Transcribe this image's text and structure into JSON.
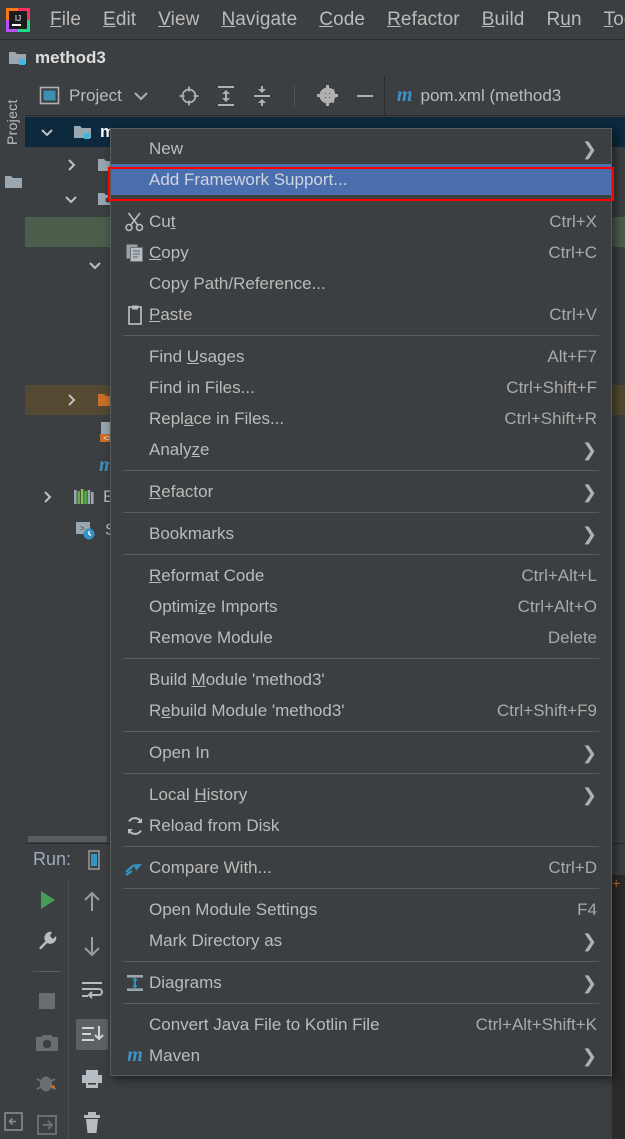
{
  "app": {
    "logo_text": "IJ",
    "menubar": [
      {
        "label": "File",
        "mnemonic": "F"
      },
      {
        "label": "Edit",
        "mnemonic": "E"
      },
      {
        "label": "View",
        "mnemonic": "V"
      },
      {
        "label": "Navigate",
        "mnemonic": "N"
      },
      {
        "label": "Code",
        "mnemonic": "C"
      },
      {
        "label": "Refactor",
        "mnemonic": "R"
      },
      {
        "label": "Build",
        "mnemonic": "B"
      },
      {
        "label": "Run",
        "mnemonic": "u"
      },
      {
        "label": "Tools",
        "mnemonic": "T"
      }
    ],
    "project_name": "method3"
  },
  "toolwindow": {
    "vertical_tab": "Project",
    "title": "Project",
    "buttons": [
      {
        "name": "locate-icon"
      },
      {
        "name": "expand-all-icon"
      },
      {
        "name": "collapse-all-icon"
      },
      {
        "name": "settings-gear-icon"
      },
      {
        "name": "hide-icon"
      }
    ]
  },
  "editor": {
    "tab_label": "pom.xml (method3",
    "tab_icon": "maven-m-icon"
  },
  "tree": {
    "rows": [
      {
        "label": "m",
        "state": "expanded",
        "icon": "module-folder-icon",
        "selected": true,
        "indent": 0
      },
      {
        "label": "",
        "state": "collapsed",
        "icon": "folder-icon",
        "indent": 1
      },
      {
        "label": "",
        "state": "expanded",
        "icon": "source-folder-icon",
        "indent": 1
      },
      {
        "label": "",
        "state": "none",
        "icon": "none",
        "indent": 2,
        "highlight": "green"
      },
      {
        "label": "",
        "state": "expanded",
        "icon": "none",
        "indent": 2
      },
      {
        "label": "",
        "state": "collapsed",
        "icon": "orange-folder-icon",
        "indent": 1,
        "highlight": "orange"
      },
      {
        "label": "",
        "state": "none",
        "icon": "xml-file-icon",
        "indent": 2
      },
      {
        "label": "",
        "state": "none",
        "icon": "maven-m-icon",
        "indent": 2
      },
      {
        "label": "Ex",
        "state": "collapsed",
        "icon": "libraries-icon",
        "indent": 0
      },
      {
        "label": "Sc",
        "state": "none",
        "icon": "scratches-icon",
        "indent": 0
      }
    ]
  },
  "run_panel": {
    "label": "Run:",
    "left_buttons": [
      {
        "name": "run-icon"
      },
      {
        "name": "wrench-icon"
      },
      {
        "name": "stop-icon"
      },
      {
        "name": "camera-icon"
      },
      {
        "name": "debug-icon"
      },
      {
        "name": "export-icon"
      }
    ],
    "right_buttons": [
      {
        "name": "arrow-up-icon"
      },
      {
        "name": "arrow-down-icon"
      },
      {
        "name": "soft-wrap-icon"
      },
      {
        "name": "scroll-to-end-icon"
      },
      {
        "name": "print-icon"
      },
      {
        "name": "trash-icon"
      }
    ]
  },
  "context_menu": {
    "items": [
      {
        "type": "item",
        "label": "New",
        "mnemonic": "",
        "accel": "",
        "submenu": true,
        "icon": "none"
      },
      {
        "type": "item",
        "label": "Add Framework Support...",
        "mnemonic": "",
        "accel": "",
        "submenu": false,
        "icon": "none",
        "highlighted": true
      },
      {
        "type": "separator"
      },
      {
        "type": "item",
        "label": "Cut",
        "mnemonic": "t",
        "accel": "Ctrl+X",
        "submenu": false,
        "icon": "scissors-icon"
      },
      {
        "type": "item",
        "label": "Copy",
        "mnemonic": "C",
        "accel": "Ctrl+C",
        "submenu": false,
        "icon": "copy-icon"
      },
      {
        "type": "item",
        "label": "Copy Path/Reference...",
        "mnemonic": "",
        "accel": "",
        "submenu": false,
        "icon": "none"
      },
      {
        "type": "item",
        "label": "Paste",
        "mnemonic": "P",
        "accel": "Ctrl+V",
        "submenu": false,
        "icon": "clipboard-icon"
      },
      {
        "type": "separator"
      },
      {
        "type": "item",
        "label": "Find Usages",
        "mnemonic": "U",
        "accel": "Alt+F7",
        "submenu": false,
        "icon": "none"
      },
      {
        "type": "item",
        "label": "Find in Files...",
        "mnemonic": "",
        "accel": "Ctrl+Shift+F",
        "submenu": false,
        "icon": "none"
      },
      {
        "type": "item",
        "label": "Replace in Files...",
        "mnemonic": "a",
        "accel": "Ctrl+Shift+R",
        "submenu": false,
        "icon": "none"
      },
      {
        "type": "item",
        "label": "Analyze",
        "mnemonic": "z",
        "accel": "",
        "submenu": true,
        "icon": "none"
      },
      {
        "type": "separator"
      },
      {
        "type": "item",
        "label": "Refactor",
        "mnemonic": "R",
        "accel": "",
        "submenu": true,
        "icon": "none"
      },
      {
        "type": "separator"
      },
      {
        "type": "item",
        "label": "Bookmarks",
        "mnemonic": "",
        "accel": "",
        "submenu": true,
        "icon": "none"
      },
      {
        "type": "separator"
      },
      {
        "type": "item",
        "label": "Reformat Code",
        "mnemonic": "R",
        "accel": "Ctrl+Alt+L",
        "submenu": false,
        "icon": "none"
      },
      {
        "type": "item",
        "label": "Optimize Imports",
        "mnemonic": "z",
        "accel": "Ctrl+Alt+O",
        "submenu": false,
        "icon": "none"
      },
      {
        "type": "item",
        "label": "Remove Module",
        "mnemonic": "",
        "accel": "Delete",
        "submenu": false,
        "icon": "none"
      },
      {
        "type": "separator"
      },
      {
        "type": "item",
        "label": "Build Module 'method3'",
        "mnemonic": "M",
        "accel": "",
        "submenu": false,
        "icon": "none"
      },
      {
        "type": "item",
        "label": "Rebuild Module 'method3'",
        "mnemonic": "e",
        "accel": "Ctrl+Shift+F9",
        "submenu": false,
        "icon": "none"
      },
      {
        "type": "separator"
      },
      {
        "type": "item",
        "label": "Open In",
        "mnemonic": "",
        "accel": "",
        "submenu": true,
        "icon": "none"
      },
      {
        "type": "separator"
      },
      {
        "type": "item",
        "label": "Local History",
        "mnemonic": "H",
        "accel": "",
        "submenu": true,
        "icon": "none"
      },
      {
        "type": "item",
        "label": "Reload from Disk",
        "mnemonic": "",
        "accel": "",
        "submenu": false,
        "icon": "reload-icon"
      },
      {
        "type": "separator"
      },
      {
        "type": "item",
        "label": "Compare With...",
        "mnemonic": "",
        "accel": "Ctrl+D",
        "submenu": false,
        "icon": "compare-icon"
      },
      {
        "type": "separator"
      },
      {
        "type": "item",
        "label": "Open Module Settings",
        "mnemonic": "",
        "accel": "F4",
        "submenu": false,
        "icon": "none"
      },
      {
        "type": "item",
        "label": "Mark Directory as",
        "mnemonic": "",
        "accel": "",
        "submenu": true,
        "icon": "none"
      },
      {
        "type": "separator"
      },
      {
        "type": "item",
        "label": "Diagrams",
        "mnemonic": "",
        "accel": "",
        "submenu": true,
        "icon": "diagrams-icon"
      },
      {
        "type": "separator"
      },
      {
        "type": "item",
        "label": "Convert Java File to Kotlin File",
        "mnemonic": "",
        "accel": "Ctrl+Alt+Shift+K",
        "submenu": false,
        "icon": "none"
      },
      {
        "type": "item",
        "label": "Maven",
        "mnemonic": "",
        "accel": "",
        "submenu": true,
        "icon": "maven-m-icon"
      }
    ]
  },
  "colors": {
    "background": "#3c3f41",
    "menu_background": "#3c3f41",
    "highlight_blue": "#4b6eaf",
    "annotation_red": "#ff0000",
    "text": "#bbbbbb",
    "accel_text": "#a9a9a9",
    "separator": "#5a5d5e",
    "tree_selected": "#0d293e",
    "tree_green": "#4c5d4c",
    "tree_orange": "#544a32",
    "maven_blue": "#3d91c4",
    "run_green": "#499c54"
  }
}
